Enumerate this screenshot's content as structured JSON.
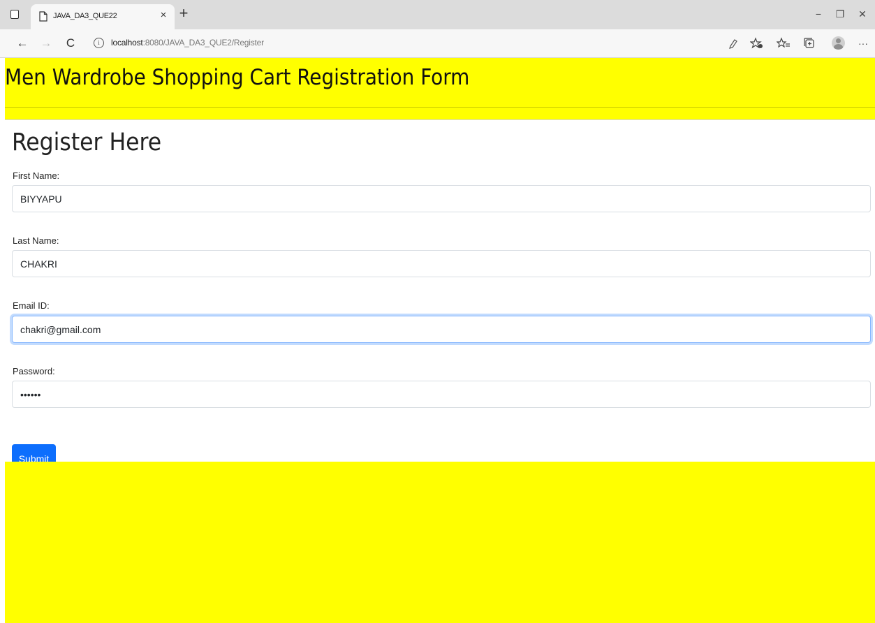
{
  "browser": {
    "tab_title": "JAVA_DA3_QUE22",
    "tab_close": "×",
    "new_tab": "+",
    "window_controls": {
      "minimize": "−",
      "restore": "❐",
      "close": "✕"
    },
    "nav": {
      "back": "←",
      "forward": "→",
      "refresh": "C"
    },
    "url_host": "localhost",
    "url_path": ":8080/JAVA_DA3_QUE2/Register",
    "toolbar_icons": [
      "read-aloud-icon",
      "favorite-add-icon",
      "favorites-icon",
      "collections-icon",
      "profile-icon",
      "more-icon"
    ],
    "more": "···"
  },
  "page": {
    "title": "Men Wardrobe Shopping Cart Registration Form",
    "form_heading": "Register Here",
    "colors": {
      "header_bg": "#ffff00",
      "button_bg": "#0d6efd"
    },
    "fields": {
      "first_name": {
        "label": "First Name:",
        "value": "BIYYAPU"
      },
      "last_name": {
        "label": "Last Name:",
        "value": "CHAKRI"
      },
      "email": {
        "label": "Email ID:",
        "value": "chakri@gmail.com"
      },
      "password": {
        "label": "Password:",
        "value": "••••••"
      }
    },
    "submit_label": "Submit"
  }
}
